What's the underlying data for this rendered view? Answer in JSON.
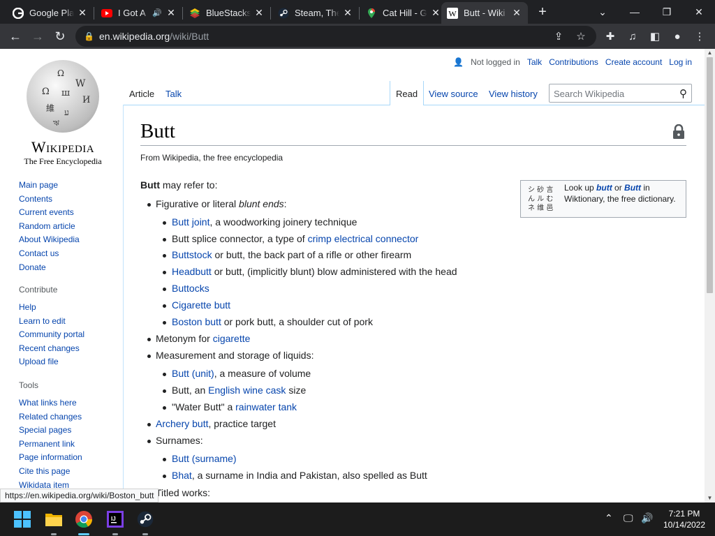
{
  "browser": {
    "tabs": [
      {
        "title": "Google Play",
        "icon": "google-icon",
        "muted_icon": false
      },
      {
        "title": "I Got A",
        "icon": "youtube-icon",
        "muted_icon": true
      },
      {
        "title": "BlueStacks",
        "icon": "bluestacks-icon",
        "muted_icon": false
      },
      {
        "title": "Steam, The",
        "icon": "steam-icon",
        "muted_icon": false
      },
      {
        "title": "Cat Hill - G",
        "icon": "maps-pin-icon",
        "muted_icon": false
      },
      {
        "title": "Butt - Wiki",
        "icon": "wikipedia-icon",
        "muted_icon": false
      }
    ],
    "url_domain": "en.wikipedia.org",
    "url_path": "/wiki/Butt",
    "status_url": "https://en.wikipedia.org/wiki/Boston_butt"
  },
  "personal": {
    "not_logged_in": "Not logged in",
    "talk": "Talk",
    "contributions": "Contributions",
    "create_account": "Create account",
    "log_in": "Log in"
  },
  "page_tabs": {
    "article": "Article",
    "talk": "Talk",
    "read": "Read",
    "view_source": "View source",
    "view_history": "View history"
  },
  "search": {
    "placeholder": "Search Wikipedia"
  },
  "logo": {
    "wordmark": "Wikipedia",
    "tagline": "The Free Encyclopedia"
  },
  "sidebar": {
    "main": [
      "Main page",
      "Contents",
      "Current events",
      "Random article",
      "About Wikipedia",
      "Contact us",
      "Donate"
    ],
    "contribute_head": "Contribute",
    "contribute": [
      "Help",
      "Learn to edit",
      "Community portal",
      "Recent changes",
      "Upload file"
    ],
    "tools_head": "Tools",
    "tools": [
      "What links here",
      "Related changes",
      "Special pages",
      "Permanent link",
      "Page information",
      "Cite this page",
      "Wikidata item"
    ]
  },
  "article": {
    "title": "Butt",
    "from": "From Wikipedia, the free encyclopedia",
    "lead_bold": "Butt",
    "lead_rest": " may refer to:",
    "fig_text": "Figurative or literal ",
    "fig_italic": "blunt ends",
    "fig_colon": ":",
    "fig_items": [
      {
        "link": "Butt joint",
        "text": ", a woodworking joinery technique"
      },
      {
        "pre": "Butt splice connector, a type of ",
        "link": "crimp electrical connector"
      },
      {
        "link": "Buttstock",
        "text": " or butt, the back part of a rifle or other firearm"
      },
      {
        "link": "Headbutt",
        "text": " or butt, (implicitly blunt) blow administered with the head"
      },
      {
        "link": "Buttocks"
      },
      {
        "link": "Cigarette butt"
      },
      {
        "link": "Boston butt",
        "text": " or pork butt, a shoulder cut of pork"
      }
    ],
    "metonym_text": "Metonym for ",
    "metonym_link": "cigarette",
    "measure_text": "Measurement and storage of liquids:",
    "measure_items": [
      {
        "link": "Butt (unit)",
        "text": ", a measure of volume"
      },
      {
        "pre": "Butt, an ",
        "link": "English wine cask",
        "text": " size"
      },
      {
        "pre": "\"Water Butt\" a ",
        "link": "rainwater tank"
      }
    ],
    "archery_link": "Archery butt",
    "archery_text": ", practice target",
    "surnames_text": "Surnames:",
    "surname_items": [
      {
        "link": "Butt (surname)"
      },
      {
        "link": "Bhat",
        "text": ", a surname in India and Pakistan, also spelled as Butt"
      }
    ],
    "titled_works": "Titled works:"
  },
  "wiktionary": {
    "pre": "Look up ",
    "link1": "butt",
    "mid": " or ",
    "link2": "Butt",
    "post": " in Wiktionary, the free dictionary."
  },
  "taskbar": {
    "time": "7:21 PM",
    "date": "10/14/2022"
  }
}
